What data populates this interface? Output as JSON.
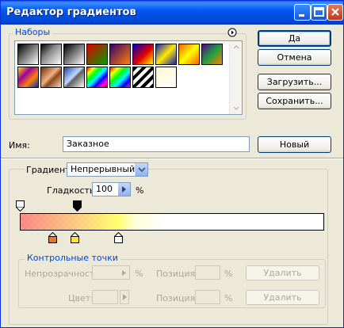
{
  "window": {
    "title": "Редактор градиентов"
  },
  "presets": {
    "label": "Наборы",
    "swatches": [
      {
        "name": "black-white",
        "bg": "linear-gradient(135deg,#000,#fff)"
      },
      {
        "name": "black-transparent",
        "bg": "linear-gradient(135deg,#000 0%,#888 40%,transparent 100%)"
      },
      {
        "name": "black-white-2",
        "bg": "linear-gradient(135deg,#000,#fff)"
      },
      {
        "name": "red-green",
        "bg": "linear-gradient(135deg,#e00000,#00a000)"
      },
      {
        "name": "violet-orange",
        "bg": "linear-gradient(135deg,#3a0070,#ff8000)"
      },
      {
        "name": "blue-red-yellow",
        "bg": "linear-gradient(135deg,#0000c0,#e00000 55%,#ffff00)"
      },
      {
        "name": "blue-yellow-blue",
        "bg": "linear-gradient(135deg,#1020c0,#ffe800 50%,#1020c0)"
      },
      {
        "name": "orange-yellow-orange",
        "bg": "linear-gradient(135deg,#ff6000,#ffff00 50%,#ff6000)"
      },
      {
        "name": "violet-green-orange",
        "bg": "linear-gradient(135deg,#5a0090,#20a040 50%,#ff8000)"
      },
      {
        "name": "yellow-violet-orange-blue",
        "bg": "linear-gradient(135deg,#ffe000,#a000a0 35%,#ff8000 65%,#0030c0)"
      },
      {
        "name": "copper",
        "bg": "linear-gradient(135deg,#6a3010,#f0b080 45%,#8a4a20 60%,#f8d8b0)"
      },
      {
        "name": "chrome",
        "bg": "linear-gradient(135deg,#2040a0,#c0d8ff 45%,#606060 55%,#fff)"
      },
      {
        "name": "spectrum",
        "bg": "linear-gradient(135deg,#f00,#ff0,#0f0,#0ff,#00f,#f0f,#f00)"
      },
      {
        "name": "transparent-rainbow",
        "bg": "linear-gradient(135deg,#f00 0%,#ff0 20%,#0f0 40%,#0ff 60%,#00f 80%,#f0f 100%)"
      },
      {
        "name": "transparent-stripes",
        "bg": "repeating-linear-gradient(135deg,#000 0 4px,#fff 4px 8px)"
      },
      {
        "name": "white-transparent",
        "bg": "linear-gradient(135deg,#fff8d0,#ffffff)"
      }
    ]
  },
  "buttons": {
    "ok": "Да",
    "cancel": "Отмена",
    "load": "Загрузить...",
    "save": "Сохранить...",
    "new": "Новый",
    "delete1": "Удалить",
    "delete2": "Удалить"
  },
  "name": {
    "label": "Имя:",
    "value": "Заказное"
  },
  "gradient": {
    "type_label": "Градиент:",
    "type_value": "Непрерывный",
    "smooth_label": "Гладкость:",
    "smooth_value": "100",
    "smooth_unit": "%"
  },
  "stops": {
    "label": "Контрольные точки",
    "opacity_label": "Непрозрачность:",
    "opacity_unit": "%",
    "position_label_1": "Позиция:",
    "position_unit_1": "%",
    "color_label": "Цвет:",
    "position_label_2": "Позиция:",
    "position_unit_2": "%"
  },
  "colors": {
    "stop1": "#e0782a",
    "stop2": "#ffe040",
    "stop3": "#ffffff"
  }
}
